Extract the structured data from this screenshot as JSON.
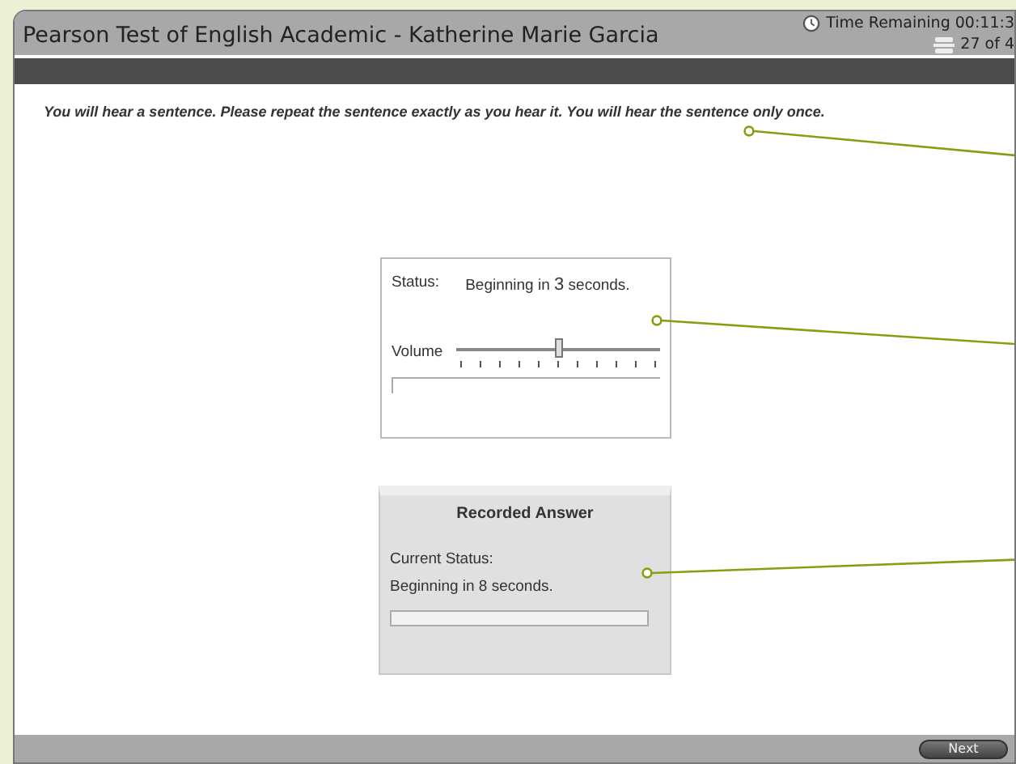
{
  "window": {
    "title": "Pearson Test of English Academic - Katherine Marie Garcia",
    "time_remaining": "Time Remaining 00:11:3",
    "progress": "27 of 4"
  },
  "instruction": "You will hear a sentence. Please repeat the sentence exactly as you hear it.  You will hear the sentence only once.",
  "audio_player": {
    "status_label": "Status:",
    "status_pre": "Beginning in ",
    "status_number": "3",
    "status_post": " seconds.",
    "volume_label": "Volume",
    "volume": {
      "level": 0.51
    },
    "playback": {
      "level": 0
    }
  },
  "recorder": {
    "title": "Recorded Answer",
    "status_label": "Current Status:",
    "status": "Beginning in 8 seconds.",
    "progress": {
      "level": 0
    }
  },
  "buttons": [
    {
      "label": "Next"
    }
  ]
}
